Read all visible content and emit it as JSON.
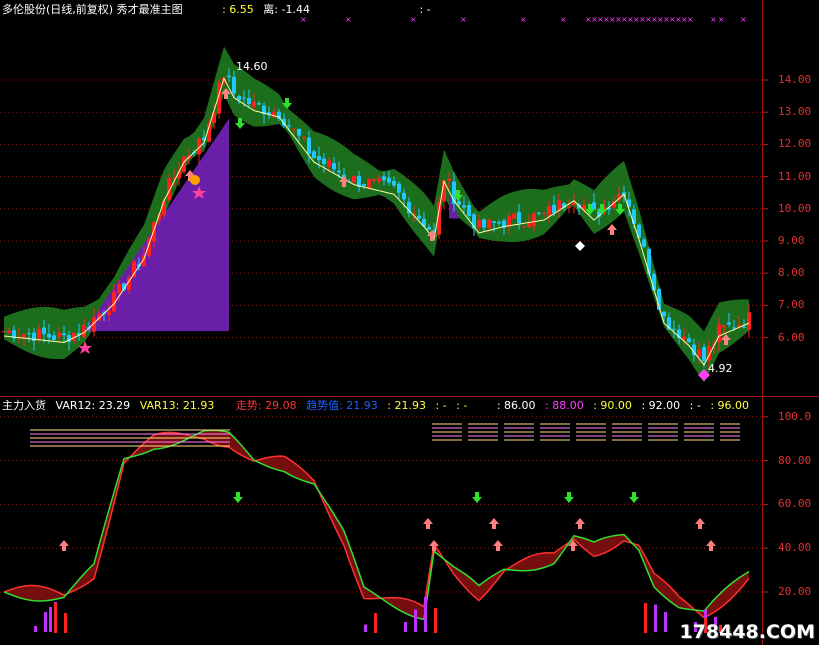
{
  "main_header": {
    "title": "多伦股份(日线,前复权) 秀才最准主图",
    "val1": ": 6.55",
    "val2_label": "离: -1.44",
    "val3": ": -"
  },
  "sub_header": {
    "name": "主力入货",
    "var12": "VAR12: 23.29",
    "var13": "VAR13: 21.93",
    "trend": "走势: 29.08",
    "trend_value": "趋势值: 21.93",
    "v5": ": 21.93",
    "v6": ": -",
    "v7": ": -",
    "v8": ": 86.00",
    "v9": ": 88.00",
    "v10": ": 90.00",
    "v11": ": 92.00",
    "v12": ": -",
    "v13": ": 96.00"
  },
  "price_axis": [
    "14.00",
    "13.00",
    "12.00",
    "11.00",
    "10.00",
    "9.00",
    "8.00",
    "7.00",
    "6.00"
  ],
  "sub_axis": [
    "100.0",
    "80.00",
    "60.00",
    "40.00",
    "20.00"
  ],
  "annotations": {
    "high": "14.60",
    "low": "4.92"
  },
  "watermark": "178448.COM",
  "colors": {
    "up": "#ff2020",
    "down": "#20c8ff",
    "band": "#1f7a1f",
    "purple": "#6a1fa8",
    "grid": "#8a1515"
  },
  "chart_data": [
    {
      "type": "candlestick",
      "ylim": [
        5.0,
        15.3
      ],
      "y_ticks": [
        6,
        7,
        8,
        9,
        10,
        11,
        12,
        13,
        14
      ],
      "high_label": 14.6,
      "low_label": 4.92
    },
    {
      "type": "line",
      "ylim": [
        0,
        105
      ],
      "y_ticks": [
        20,
        40,
        60,
        80,
        100
      ],
      "series": [
        {
          "name": "VAR12",
          "last": 23.29
        },
        {
          "name": "VAR13",
          "last": 21.93
        }
      ]
    }
  ]
}
